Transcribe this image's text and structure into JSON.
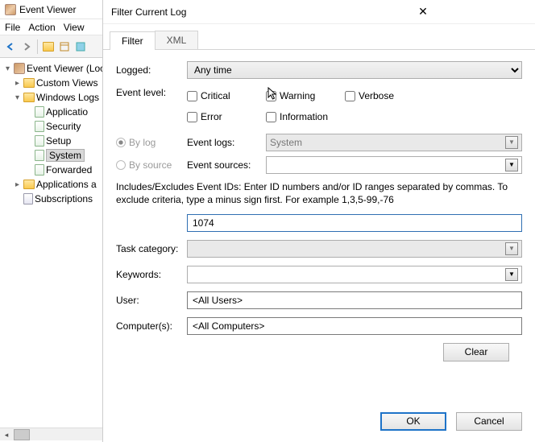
{
  "bg": {
    "title": "Event Viewer",
    "menu": {
      "file": "File",
      "action": "Action",
      "view": "View"
    },
    "tree": {
      "root": "Event Viewer (Loc",
      "custom": "Custom Views",
      "winlogs": "Windows Logs",
      "logs": {
        "app": "Applicatio",
        "sec": "Security",
        "setup": "Setup",
        "sys": "System",
        "fwd": "Forwarded"
      },
      "apps": "Applications a",
      "subs": "Subscriptions"
    }
  },
  "dlg": {
    "title": "Filter Current Log",
    "tabs": {
      "filter": "Filter",
      "xml": "XML"
    },
    "logged": {
      "label": "Logged:",
      "value": "Any time"
    },
    "level": {
      "label": "Event level:",
      "critical": "Critical",
      "warning": "Warning",
      "verbose": "Verbose",
      "error": "Error",
      "information": "Information"
    },
    "bylog": {
      "label": "By log",
      "field": "Event logs:",
      "value": "System"
    },
    "bysource": {
      "label": "By source",
      "field": "Event sources:",
      "value": ""
    },
    "help": "Includes/Excludes Event IDs: Enter ID numbers and/or ID ranges separated by commas. To exclude criteria, type a minus sign first. For example 1,3,5-99,-76",
    "idvalue": "1074",
    "taskcat": {
      "label": "Task category:",
      "value": ""
    },
    "keywords": {
      "label": "Keywords:",
      "value": ""
    },
    "user": {
      "label": "User:",
      "value": "<All Users>"
    },
    "computers": {
      "label": "Computer(s):",
      "value": "<All Computers>"
    },
    "clear": "Clear",
    "ok": "OK",
    "cancel": "Cancel"
  }
}
